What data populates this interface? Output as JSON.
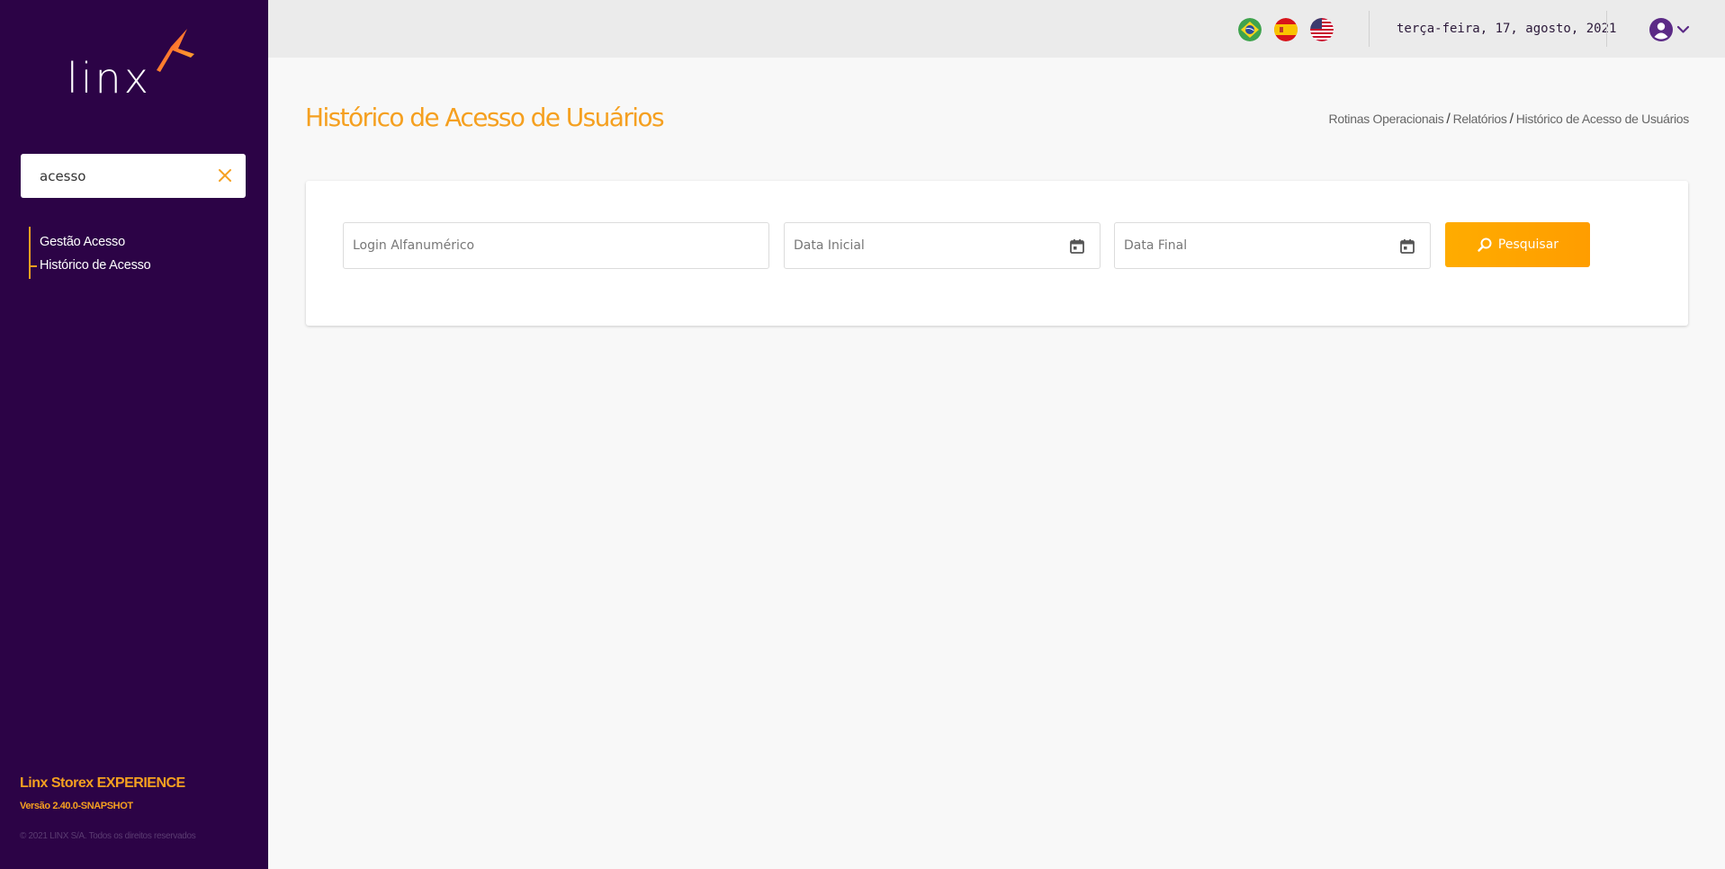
{
  "sidebar": {
    "logo_text": "linx",
    "search": {
      "value": "acesso",
      "placeholder": ""
    },
    "items": [
      {
        "label": "Gestão Acesso"
      },
      {
        "label": "Histórico de Acesso"
      }
    ],
    "footer": {
      "product": "Linx Storex EXPERIENCE",
      "version": "Versão 2.40.0-SNAPSHOT",
      "copyright": "© 2021 LINX S/A. Todos os direitos reservados"
    }
  },
  "header": {
    "languages": [
      "flag-brazil",
      "flag-spain",
      "flag-usa"
    ],
    "date": "terça-feira, 17, agosto, 2021",
    "user_icon": "user-circle-icon"
  },
  "page": {
    "title": "Histórico de Acesso de Usuários",
    "breadcrumb": [
      "Rotinas Operacionais",
      "Relatórios",
      "Histórico de Acesso de Usuários"
    ]
  },
  "form": {
    "login_placeholder": "Login Alfanumérico",
    "start_placeholder": "Data Inicial",
    "end_placeholder": "Data Final",
    "search_label": "Pesquisar"
  },
  "colors": {
    "sidebar": "#2c0346",
    "accent": "#f5a020",
    "user_icon": "#5b2a86"
  }
}
